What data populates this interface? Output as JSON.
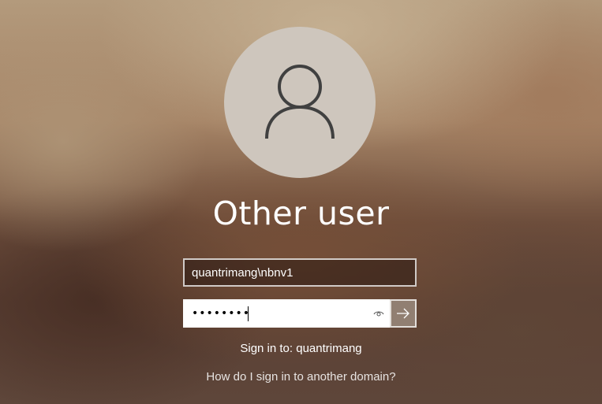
{
  "user": {
    "display_name": "Other user",
    "avatar_icon": "person-outline-icon"
  },
  "username_field": {
    "value": "quantrimang\\nbnv1"
  },
  "password_field": {
    "masked_value": "••••••••",
    "reveal_icon": "eye-icon"
  },
  "submit": {
    "icon": "arrow-right-icon"
  },
  "sign_in_to": "Sign in to: quantrimang",
  "help_link": "How do I sign in to another domain?",
  "colors": {
    "avatar_bg": "#cec6bd",
    "avatar_icon": "#404040",
    "submit_bg": "#917f72",
    "text": "#ffffff"
  }
}
